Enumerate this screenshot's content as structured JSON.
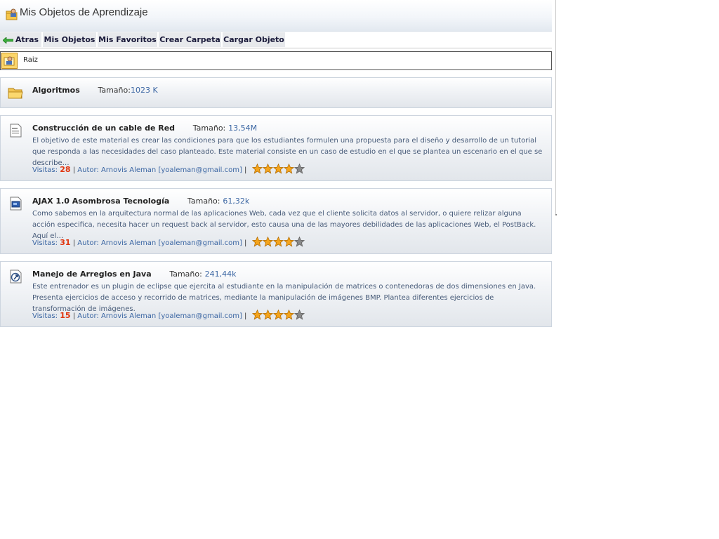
{
  "header": {
    "title": "Mis Objetos de Aprendizaje",
    "icon": "user-folder-icon"
  },
  "toolbar": {
    "back_label": "Atras",
    "my_objects_label": "Mis Objetos",
    "my_favorites_label": "Mis Favoritos",
    "create_folder_label": "Crear Carpeta",
    "upload_object_label": "Cargar Objeto"
  },
  "breadcrumb": {
    "label": "Raiz",
    "icon": "root-folder-icon"
  },
  "folder": {
    "name": "Algoritmos",
    "size_label": "Tamaño:",
    "size": "1023 K",
    "icon": "folder-icon"
  },
  "items": [
    {
      "title": "Construcción de un cable de Red",
      "size_label": "Tamaño:",
      "size": "13,54M",
      "description": "El objetivo de este material es crear las condiciones para que los estudiantes formulen una propuesta para el diseño y desarrollo de un tutorial que responda a las necesidades del caso planteado. Este material consiste en un caso de estudio en el que se plantea un escenario en el que se describe…",
      "visits_label": "Visitas:",
      "visits": "28",
      "author": "Autor: Arnovis Aleman [yoaleman@gmail.com]",
      "rating": 4,
      "rating_max": 5,
      "icon": "document-icon"
    },
    {
      "title": "AJAX 1.0 Asombrosa Tecnología",
      "size_label": "Tamaño:",
      "size": "61,32k",
      "description": "Como sabemos en la arquitectura normal de las aplicaciones Web, cada vez que el cliente solicita datos al servidor, o quiere relizar alguna acción especifica, necesita hacer un request back al servidor, esto causa una de las mayores debilidades de las aplicaciones Web, el PostBack. Aquí el…",
      "visits_label": "Visitas:",
      "visits": "31",
      "author": "Autor: Arnovis Aleman [yoaleman@gmail.com]",
      "rating": 4,
      "rating_max": 5,
      "icon": "presentation-icon"
    },
    {
      "title": "Manejo de Arreglos en Java",
      "size_label": "Tamaño:",
      "size": "241,44k",
      "description": "Este entrenador es un plugin de eclipse que ejercita al estudiante en la manipulación de matrices o contenedoras de dos dimensiones en Java. Presenta ejercicios de acceso y recorrido de matrices, mediante la manipulación de imágenes BMP. Plantea diferentes ejercicios de transformación de imágenes.",
      "visits_label": "Visitas:",
      "visits": "15",
      "author": "Autor: Arnovis Aleman [yoaleman@gmail.com]",
      "rating": 4,
      "rating_max": 5,
      "icon": "shortcut-icon"
    }
  ],
  "colors": {
    "link": "#3b66a3",
    "visits": "#e0350f",
    "star_on": "#f4a41c",
    "star_off": "#8a8a8a"
  }
}
